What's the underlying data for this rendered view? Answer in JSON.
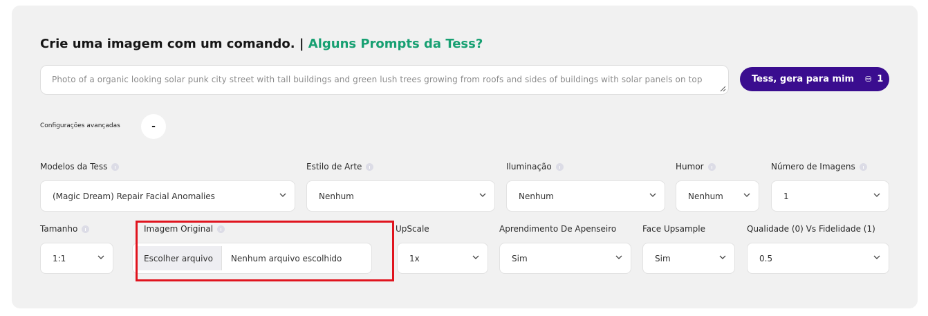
{
  "header": {
    "title": "Crie uma imagem com um comando. |",
    "link": "Alguns Prompts da Tess?"
  },
  "prompt": {
    "placeholder": "Photo of a organic looking solar punk city street with tall buildings and green lush trees growing from roofs and sides of buildings with solar panels on top"
  },
  "generate_button": {
    "label": "Tess, gera para mim",
    "coin_icon": "coins-icon",
    "count": "1"
  },
  "advanced": {
    "label": "Configurações avançadas",
    "toggle": "-"
  },
  "row1": [
    {
      "label": "Modelos da Tess",
      "value": "(Magic Dream) Repair Facial Anomalies",
      "info": true
    },
    {
      "label": "Estilo de Arte",
      "value": "Nenhum",
      "info": true
    },
    {
      "label": "Iluminação",
      "value": "Nenhum",
      "info": true
    },
    {
      "label": "Humor",
      "value": "Nenhum",
      "info": true
    },
    {
      "label": "Número de Imagens",
      "value": "1",
      "info": true
    }
  ],
  "row2": {
    "tamanho": {
      "label": "Tamanho",
      "value": "1:1",
      "info": true
    },
    "imagem_original": {
      "label": "Imagem Original",
      "button": "Escolher arquivo",
      "status": "Nenhum arquivo escolhido",
      "info": true
    },
    "upscale": {
      "label": "UpScale",
      "value": "1x"
    },
    "aprendimento": {
      "label": "Aprendimento De Apenseiro",
      "value": "Sim"
    },
    "face_upsample": {
      "label": "Face Upsample",
      "value": "Sim"
    },
    "qualidade": {
      "label": "Qualidade (0) Vs Fidelidade (1)",
      "value": "0.5"
    }
  },
  "colors": {
    "accent": "#17a072",
    "button": "#3a0d8f",
    "highlight": "#e0141e",
    "panel": "#f1f1f1"
  }
}
